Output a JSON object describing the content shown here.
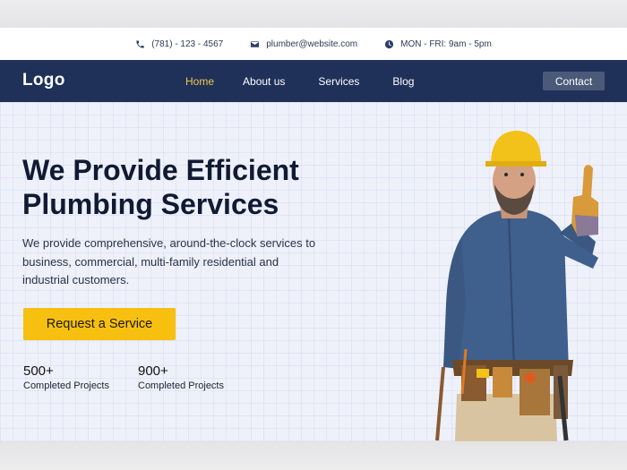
{
  "topbar": {
    "phone": "(781) - 123 - 4567",
    "email": "plumber@website.com",
    "hours": "MON - FRI: 9am - 5pm"
  },
  "nav": {
    "logo": "Logo",
    "links": [
      "Home",
      "About us",
      "Services",
      "Blog"
    ],
    "active": "Home",
    "contact": "Contact"
  },
  "hero": {
    "title_line1": "We Provide Efficient",
    "title_line2": "Plumbing Services",
    "description": "We provide comprehensive, around-the-clock services to business, commercial, multi-family residential and industrial customers.",
    "cta": "Request a Service",
    "stats": [
      {
        "number": "500+",
        "label": "Completed Projects"
      },
      {
        "number": "900+",
        "label": "Completed Projects"
      }
    ]
  },
  "colors": {
    "navy": "#1f3159",
    "accent_yellow": "#f7c010",
    "active_link": "#f3c64b",
    "hero_bg": "#eef1fa"
  },
  "icons": [
    "phone-icon",
    "mail-icon",
    "clock-icon"
  ]
}
